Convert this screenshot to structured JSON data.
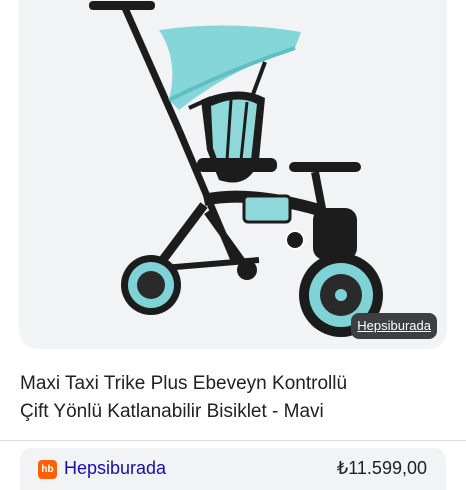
{
  "product": {
    "image_alt": "Maxi Taxi Trike tricycle with canopy and parent handle",
    "image_source": "Hepsiburada",
    "title_line1": "Maxi Taxi Trike Plus Ebeveyn Kontrollü",
    "title_line2": "Çift Yönlü Katlanabilir Bisiklet - Mavi"
  },
  "merchant": {
    "logo_text": "hb",
    "name": "Hepsiburada",
    "price": "₺11.599,00"
  },
  "colors": {
    "accent_mint": "#7fd3d6",
    "frame": "#1c1c1c",
    "merchant_orange": "#ff6000"
  },
  "icons": {
    "merchant_logo": "hepsiburada-logo-icon"
  }
}
